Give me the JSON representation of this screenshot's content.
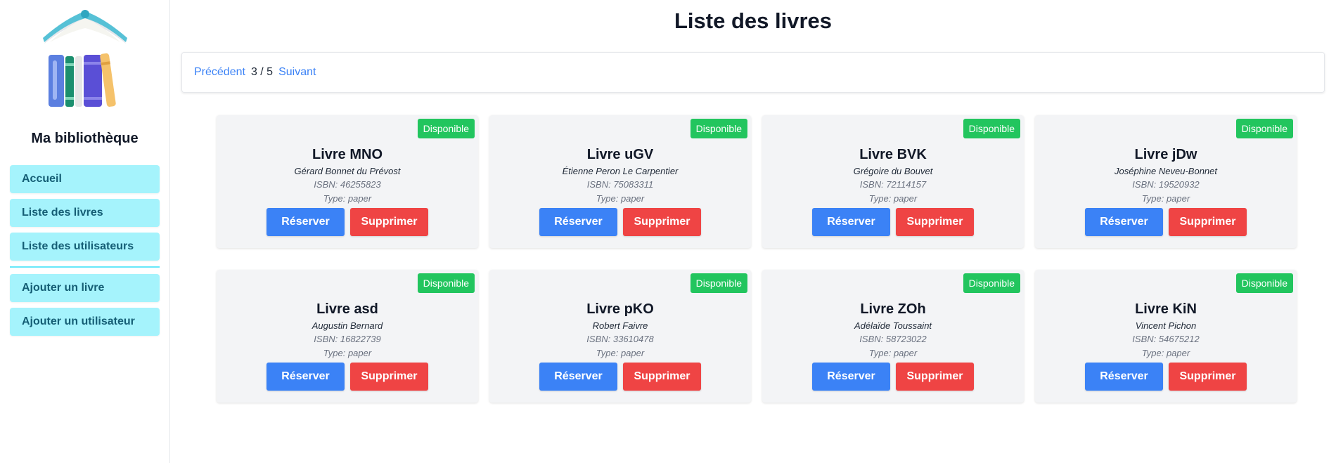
{
  "sidebar": {
    "logo_icon": "books-logo-icon",
    "brand": "Ma bibliothèque",
    "nav": [
      {
        "label": "Accueil"
      },
      {
        "label": "Liste des livres"
      },
      {
        "label": "Liste des utilisateurs"
      }
    ],
    "nav_secondary": [
      {
        "label": "Ajouter un livre"
      },
      {
        "label": "Ajouter un utilisateur"
      }
    ]
  },
  "main": {
    "title": "Liste des livres",
    "pagination": {
      "prev_label": "Précédent",
      "page": "3 / 5",
      "next_label": "Suivant"
    },
    "reserve_label": "Réserver",
    "delete_label": "Supprimer",
    "books": [
      {
        "status": "Disponible",
        "title": "Livre MNO",
        "author": "Gérard Bonnet du Prévost",
        "isbn": "ISBN: 46255823",
        "type": "Type: paper"
      },
      {
        "status": "Disponible",
        "title": "Livre uGV",
        "author": "Étienne Peron Le Carpentier",
        "isbn": "ISBN: 75083311",
        "type": "Type: paper"
      },
      {
        "status": "Disponible",
        "title": "Livre BVK",
        "author": "Grégoire du Bouvet",
        "isbn": "ISBN: 72114157",
        "type": "Type: paper"
      },
      {
        "status": "Disponible",
        "title": "Livre jDw",
        "author": "Joséphine Neveu-Bonnet",
        "isbn": "ISBN: 19520932",
        "type": "Type: paper"
      },
      {
        "status": "Disponible",
        "title": "Livre asd",
        "author": "Augustin Bernard",
        "isbn": "ISBN: 16822739",
        "type": "Type: paper"
      },
      {
        "status": "Disponible",
        "title": "Livre pKO",
        "author": "Robert Faivre",
        "isbn": "ISBN: 33610478",
        "type": "Type: paper"
      },
      {
        "status": "Disponible",
        "title": "Livre ZOh",
        "author": "Adélaïde Toussaint",
        "isbn": "ISBN: 58723022",
        "type": "Type: paper"
      },
      {
        "status": "Disponible",
        "title": "Livre KiN",
        "author": "Vincent Pichon",
        "isbn": "ISBN: 54675212",
        "type": "Type: paper"
      }
    ]
  },
  "colors": {
    "nav_bg": "#a5f3fc",
    "nav_text": "#155e75",
    "badge": "#22c55e",
    "reserve": "#3b82f6",
    "delete": "#ef4444",
    "card_bg": "#f3f4f6",
    "link": "#3b82f6"
  }
}
